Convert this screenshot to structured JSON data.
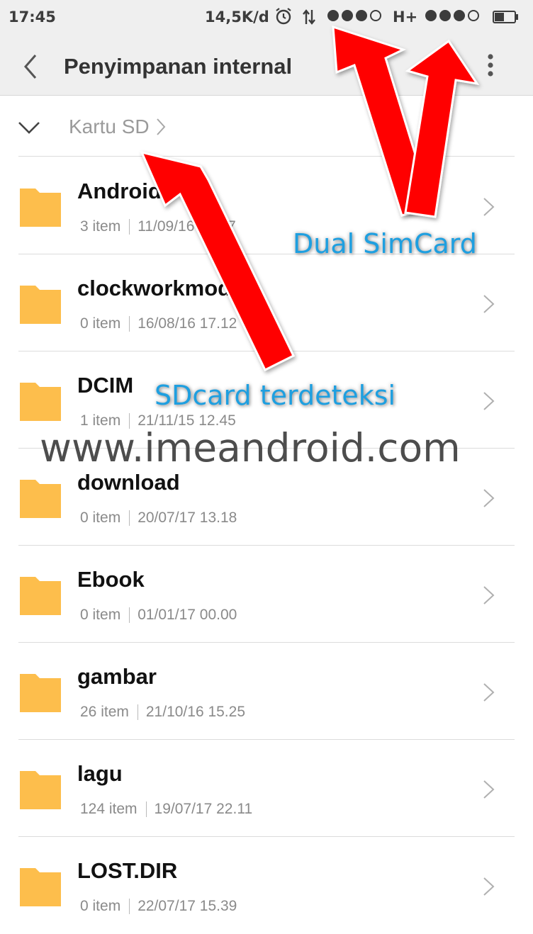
{
  "status_bar": {
    "time": "17:45",
    "speed": "14,5K/d",
    "network_type": "H+",
    "icons": [
      "alarm-icon",
      "data-transfer-icon",
      "signal-icon",
      "battery-icon"
    ]
  },
  "header": {
    "title": "Penyimpanan internal",
    "back_icon": "back-chevron-icon",
    "menu_icon": "more-vertical-icon"
  },
  "breadcrumb": {
    "label": "Kartu SD",
    "toggle_icon": "chevron-down-icon"
  },
  "folders": [
    {
      "name": "Android",
      "count": "3 item",
      "date": "11/09/16 03.17"
    },
    {
      "name": "clockworkmod",
      "count": "0 item",
      "date": "16/08/16 17.12"
    },
    {
      "name": "DCIM",
      "count": "1 item",
      "date": "21/11/15 12.45"
    },
    {
      "name": "download",
      "count": "0 item",
      "date": "20/07/17 13.18"
    },
    {
      "name": "Ebook",
      "count": "0 item",
      "date": "01/01/17 00.00"
    },
    {
      "name": "gambar",
      "count": "26 item",
      "date": "21/10/16 15.25"
    },
    {
      "name": "lagu",
      "count": "124 item",
      "date": "19/07/17 22.11"
    },
    {
      "name": "LOST.DIR",
      "count": "0 item",
      "date": "22/07/17 15.39"
    }
  ],
  "annotations": {
    "dual_sim": "Dual SimCard",
    "sdcard": "SDcard terdeteksi",
    "watermark": "www.imeandroid.com"
  },
  "colors": {
    "folder": "#FDBE4C",
    "arrow": "#FF0000",
    "annotation_text": "#1E9FE0",
    "header_bg": "#EFEFEF"
  }
}
